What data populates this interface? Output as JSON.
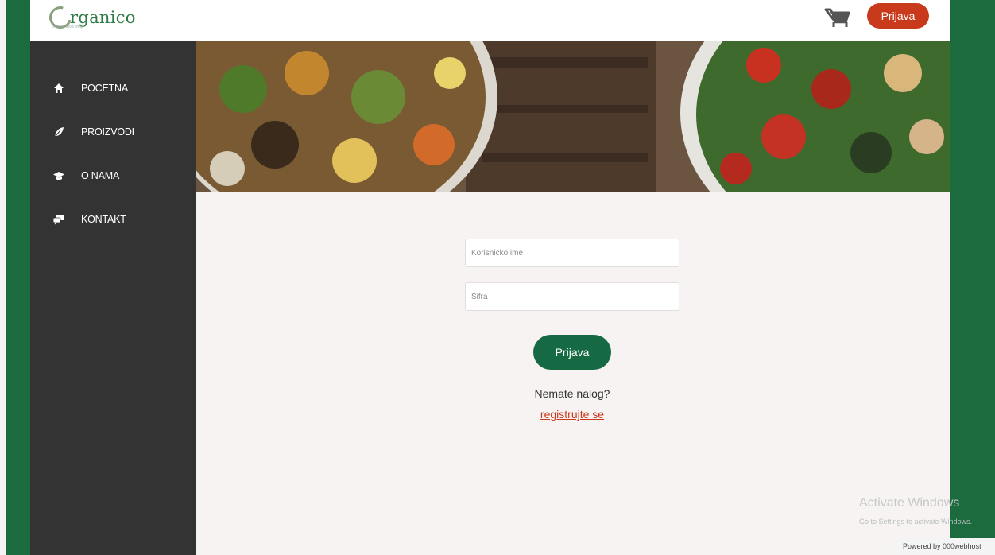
{
  "header": {
    "logo_text": "rganico",
    "logo_tagline": "organic food shop",
    "login_button": "Prijava"
  },
  "sidebar": {
    "items": [
      {
        "label": "POCETNA",
        "icon": "home-icon"
      },
      {
        "label": "PROIZVODI",
        "icon": "leaf-icon"
      },
      {
        "label": "O NAMA",
        "icon": "graduation-cap-icon"
      },
      {
        "label": "KONTAKT",
        "icon": "chat-icon"
      }
    ]
  },
  "login_form": {
    "username_placeholder": "Korisnicko ime",
    "password_placeholder": "Sifra",
    "submit_label": "Prijava",
    "no_account_text": "Nemate nalog?",
    "register_link": "registrujte se"
  },
  "overlay": {
    "watermark_title": "Activate Windows",
    "watermark_sub": "Go to Settings to activate Windows.",
    "powered_by": "Powered by 000webhost"
  },
  "colors": {
    "frame_green": "#1b6b3f",
    "sidebar_bg": "#333333",
    "accent_red": "#c9391c",
    "button_green": "#156a43",
    "main_bg": "#f7f3f3"
  }
}
